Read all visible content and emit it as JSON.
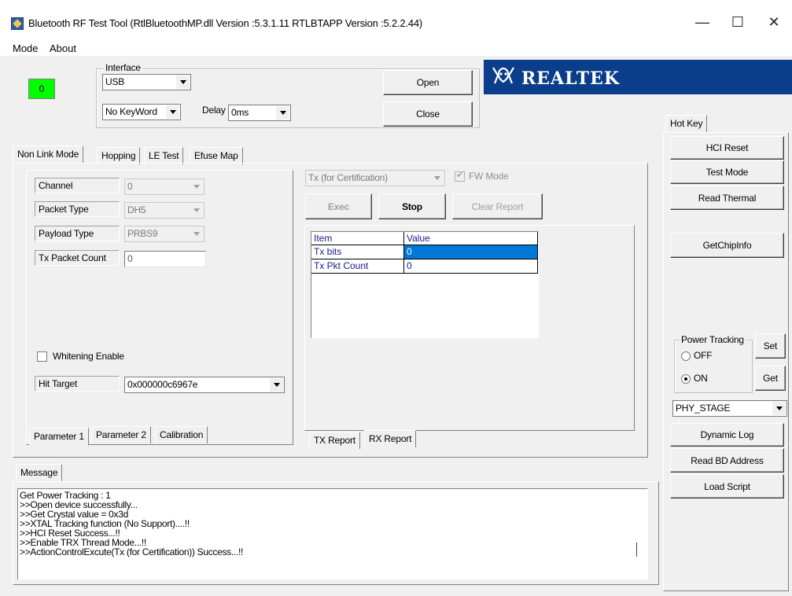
{
  "window": {
    "title": "Bluetooth RF Test Tool (RtlBluetoothMP.dll Version :5.3.1.11   RTLBTAPP Version :5.2.2.44)",
    "minimize": "—",
    "maximize": "☐",
    "close": "✕"
  },
  "menu": {
    "items": [
      "Mode",
      "About"
    ]
  },
  "status_indicator": {
    "value": "0",
    "color": "#00ff00"
  },
  "interface": {
    "legend": "Interface",
    "interface_value": "USB",
    "keyword_value": "No KeyWord",
    "delay_label": "Delay",
    "delay_value": "0ms",
    "open_button": "Open",
    "close_button": "Close"
  },
  "brand": {
    "name": "REALTEK",
    "color": "#0a3d8a"
  },
  "main_tabs": [
    "Non Link Mode",
    "Hopping",
    "LE Test",
    "Efuse Map"
  ],
  "params": {
    "channel_label": "Channel",
    "channel_value": "0",
    "packet_type_label": "Packet Type",
    "packet_type_value": "DH5",
    "payload_type_label": "Payload Type",
    "payload_type_value": "PRBS9",
    "tx_packet_count_label": "Tx Packet Count",
    "tx_packet_count_value": "0",
    "whitening_label": "Whitening Enable",
    "hit_target_label": "Hit Target",
    "hit_target_value": "0x000000c6967e"
  },
  "param_tabs": [
    "Parameter 1",
    "Parameter 2",
    "Calibration"
  ],
  "test": {
    "mode_value": "Tx (for Certification)",
    "fw_mode_label": "FW Mode",
    "exec_button": "Exec",
    "stop_button": "Stop",
    "clear_report_button": "Clear Report"
  },
  "report": {
    "headers": [
      "Item",
      "Value"
    ],
    "rows": [
      {
        "item": "Tx bits",
        "value": "0"
      },
      {
        "item": "Tx Pkt Count",
        "value": "0"
      }
    ]
  },
  "report_tabs": [
    "TX Report",
    "RX Report"
  ],
  "message": {
    "tab": "Message",
    "lines": [
      "Get Power Tracking : 1",
      ">>Open device successfully...",
      ">>Get Crystal value = 0x3d",
      ">>XTAL Tracking function (No Support)....!!",
      ">>HCI Reset Success...!!",
      ">>Enable TRX Thread Mode...!!",
      ">>ActionControlExcute(Tx (for Certification)) Success...!!"
    ]
  },
  "hotkey": {
    "tab": "Hot Key",
    "hci_reset": "HCI Reset",
    "test_mode": "Test Mode",
    "read_thermal": "Read Thermal",
    "get_chip_info": "GetChipInfo",
    "power_tracking_legend": "Power Tracking",
    "off_label": "OFF",
    "on_label": "ON",
    "set_button": "Set",
    "get_button": "Get",
    "stage_value": "PHY_STAGE",
    "dynamic_log": "Dynamic Log",
    "read_bd_address": "Read BD Address",
    "load_script": "Load Script"
  }
}
